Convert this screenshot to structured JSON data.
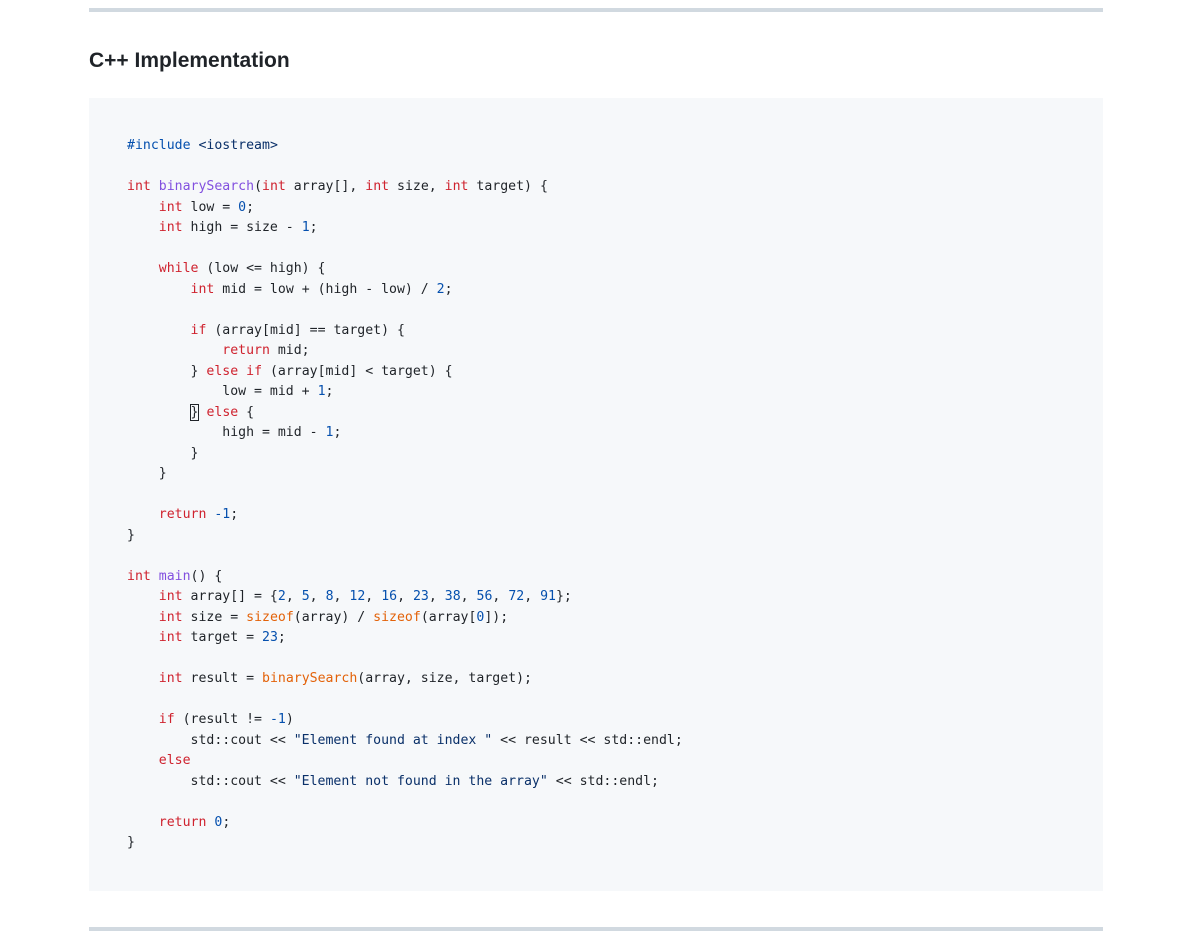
{
  "heading": "C++ Implementation",
  "code": {
    "language": "cpp",
    "lines": [
      [
        {
          "t": "#include",
          "c": "pp"
        },
        {
          "t": " ",
          "c": "plain"
        },
        {
          "t": "<iostream>",
          "c": "inc"
        }
      ],
      [],
      [
        {
          "t": "int",
          "c": "kw"
        },
        {
          "t": " ",
          "c": "plain"
        },
        {
          "t": "binarySearch",
          "c": "fn"
        },
        {
          "t": "(",
          "c": "plain"
        },
        {
          "t": "int",
          "c": "kw"
        },
        {
          "t": " array[], ",
          "c": "plain"
        },
        {
          "t": "int",
          "c": "kw"
        },
        {
          "t": " size, ",
          "c": "plain"
        },
        {
          "t": "int",
          "c": "kw"
        },
        {
          "t": " target) {",
          "c": "plain"
        }
      ],
      [
        {
          "t": "    ",
          "c": "plain"
        },
        {
          "t": "int",
          "c": "kw"
        },
        {
          "t": " low = ",
          "c": "plain"
        },
        {
          "t": "0",
          "c": "num"
        },
        {
          "t": ";",
          "c": "plain"
        }
      ],
      [
        {
          "t": "    ",
          "c": "plain"
        },
        {
          "t": "int",
          "c": "kw"
        },
        {
          "t": " high = size - ",
          "c": "plain"
        },
        {
          "t": "1",
          "c": "num"
        },
        {
          "t": ";",
          "c": "plain"
        }
      ],
      [],
      [
        {
          "t": "    ",
          "c": "plain"
        },
        {
          "t": "while",
          "c": "kw"
        },
        {
          "t": " (low <= high) {",
          "c": "plain"
        }
      ],
      [
        {
          "t": "        ",
          "c": "plain"
        },
        {
          "t": "int",
          "c": "kw"
        },
        {
          "t": " mid = low + (high - low) / ",
          "c": "plain"
        },
        {
          "t": "2",
          "c": "num"
        },
        {
          "t": ";",
          "c": "plain"
        }
      ],
      [],
      [
        {
          "t": "        ",
          "c": "plain"
        },
        {
          "t": "if",
          "c": "kw"
        },
        {
          "t": " (array[mid] == target) {",
          "c": "plain"
        }
      ],
      [
        {
          "t": "            ",
          "c": "plain"
        },
        {
          "t": "return",
          "c": "kw"
        },
        {
          "t": " mid;",
          "c": "plain"
        }
      ],
      [
        {
          "t": "        } ",
          "c": "plain"
        },
        {
          "t": "else",
          "c": "kw"
        },
        {
          "t": " ",
          "c": "plain"
        },
        {
          "t": "if",
          "c": "kw"
        },
        {
          "t": " (array[mid] < target) {",
          "c": "plain"
        }
      ],
      [
        {
          "t": "            low = mid + ",
          "c": "plain"
        },
        {
          "t": "1",
          "c": "num"
        },
        {
          "t": ";",
          "c": "plain"
        }
      ],
      [
        {
          "t": "        ",
          "c": "plain"
        },
        {
          "t": "}",
          "c": "cursor"
        },
        {
          "t": " ",
          "c": "plain"
        },
        {
          "t": "else",
          "c": "kw"
        },
        {
          "t": " {",
          "c": "plain"
        }
      ],
      [
        {
          "t": "            high = mid - ",
          "c": "plain"
        },
        {
          "t": "1",
          "c": "num"
        },
        {
          "t": ";",
          "c": "plain"
        }
      ],
      [
        {
          "t": "        }",
          "c": "plain"
        }
      ],
      [
        {
          "t": "    }",
          "c": "plain"
        }
      ],
      [],
      [
        {
          "t": "    ",
          "c": "plain"
        },
        {
          "t": "return",
          "c": "kw"
        },
        {
          "t": " ",
          "c": "plain"
        },
        {
          "t": "-1",
          "c": "num"
        },
        {
          "t": ";",
          "c": "plain"
        }
      ],
      [
        {
          "t": "}",
          "c": "plain"
        }
      ],
      [],
      [
        {
          "t": "int",
          "c": "kw"
        },
        {
          "t": " ",
          "c": "plain"
        },
        {
          "t": "main",
          "c": "fn"
        },
        {
          "t": "() {",
          "c": "plain"
        }
      ],
      [
        {
          "t": "    ",
          "c": "plain"
        },
        {
          "t": "int",
          "c": "kw"
        },
        {
          "t": " array[] = {",
          "c": "plain"
        },
        {
          "t": "2",
          "c": "num"
        },
        {
          "t": ", ",
          "c": "plain"
        },
        {
          "t": "5",
          "c": "num"
        },
        {
          "t": ", ",
          "c": "plain"
        },
        {
          "t": "8",
          "c": "num"
        },
        {
          "t": ", ",
          "c": "plain"
        },
        {
          "t": "12",
          "c": "num"
        },
        {
          "t": ", ",
          "c": "plain"
        },
        {
          "t": "16",
          "c": "num"
        },
        {
          "t": ", ",
          "c": "plain"
        },
        {
          "t": "23",
          "c": "num"
        },
        {
          "t": ", ",
          "c": "plain"
        },
        {
          "t": "38",
          "c": "num"
        },
        {
          "t": ", ",
          "c": "plain"
        },
        {
          "t": "56",
          "c": "num"
        },
        {
          "t": ", ",
          "c": "plain"
        },
        {
          "t": "72",
          "c": "num"
        },
        {
          "t": ", ",
          "c": "plain"
        },
        {
          "t": "91",
          "c": "num"
        },
        {
          "t": "};",
          "c": "plain"
        }
      ],
      [
        {
          "t": "    ",
          "c": "plain"
        },
        {
          "t": "int",
          "c": "kw"
        },
        {
          "t": " size = ",
          "c": "plain"
        },
        {
          "t": "sizeof",
          "c": "fn2"
        },
        {
          "t": "(array) / ",
          "c": "plain"
        },
        {
          "t": "sizeof",
          "c": "fn2"
        },
        {
          "t": "(array[",
          "c": "plain"
        },
        {
          "t": "0",
          "c": "num"
        },
        {
          "t": "]);",
          "c": "plain"
        }
      ],
      [
        {
          "t": "    ",
          "c": "plain"
        },
        {
          "t": "int",
          "c": "kw"
        },
        {
          "t": " target = ",
          "c": "plain"
        },
        {
          "t": "23",
          "c": "num"
        },
        {
          "t": ";",
          "c": "plain"
        }
      ],
      [],
      [
        {
          "t": "    ",
          "c": "plain"
        },
        {
          "t": "int",
          "c": "kw"
        },
        {
          "t": " result = ",
          "c": "plain"
        },
        {
          "t": "binarySearch",
          "c": "fn2"
        },
        {
          "t": "(array, size, target);",
          "c": "plain"
        }
      ],
      [],
      [
        {
          "t": "    ",
          "c": "plain"
        },
        {
          "t": "if",
          "c": "kw"
        },
        {
          "t": " (result != ",
          "c": "plain"
        },
        {
          "t": "-1",
          "c": "num"
        },
        {
          "t": ")",
          "c": "plain"
        }
      ],
      [
        {
          "t": "        std::cout << ",
          "c": "plain"
        },
        {
          "t": "\"Element found at index \"",
          "c": "str"
        },
        {
          "t": " << result << std::endl;",
          "c": "plain"
        }
      ],
      [
        {
          "t": "    ",
          "c": "plain"
        },
        {
          "t": "else",
          "c": "kw"
        }
      ],
      [
        {
          "t": "        std::cout << ",
          "c": "plain"
        },
        {
          "t": "\"Element not found in the array\"",
          "c": "str"
        },
        {
          "t": " << std::endl;",
          "c": "plain"
        }
      ],
      [],
      [
        {
          "t": "    ",
          "c": "plain"
        },
        {
          "t": "return",
          "c": "kw"
        },
        {
          "t": " ",
          "c": "plain"
        },
        {
          "t": "0",
          "c": "num"
        },
        {
          "t": ";",
          "c": "plain"
        }
      ],
      [
        {
          "t": "}",
          "c": "plain"
        }
      ]
    ]
  }
}
